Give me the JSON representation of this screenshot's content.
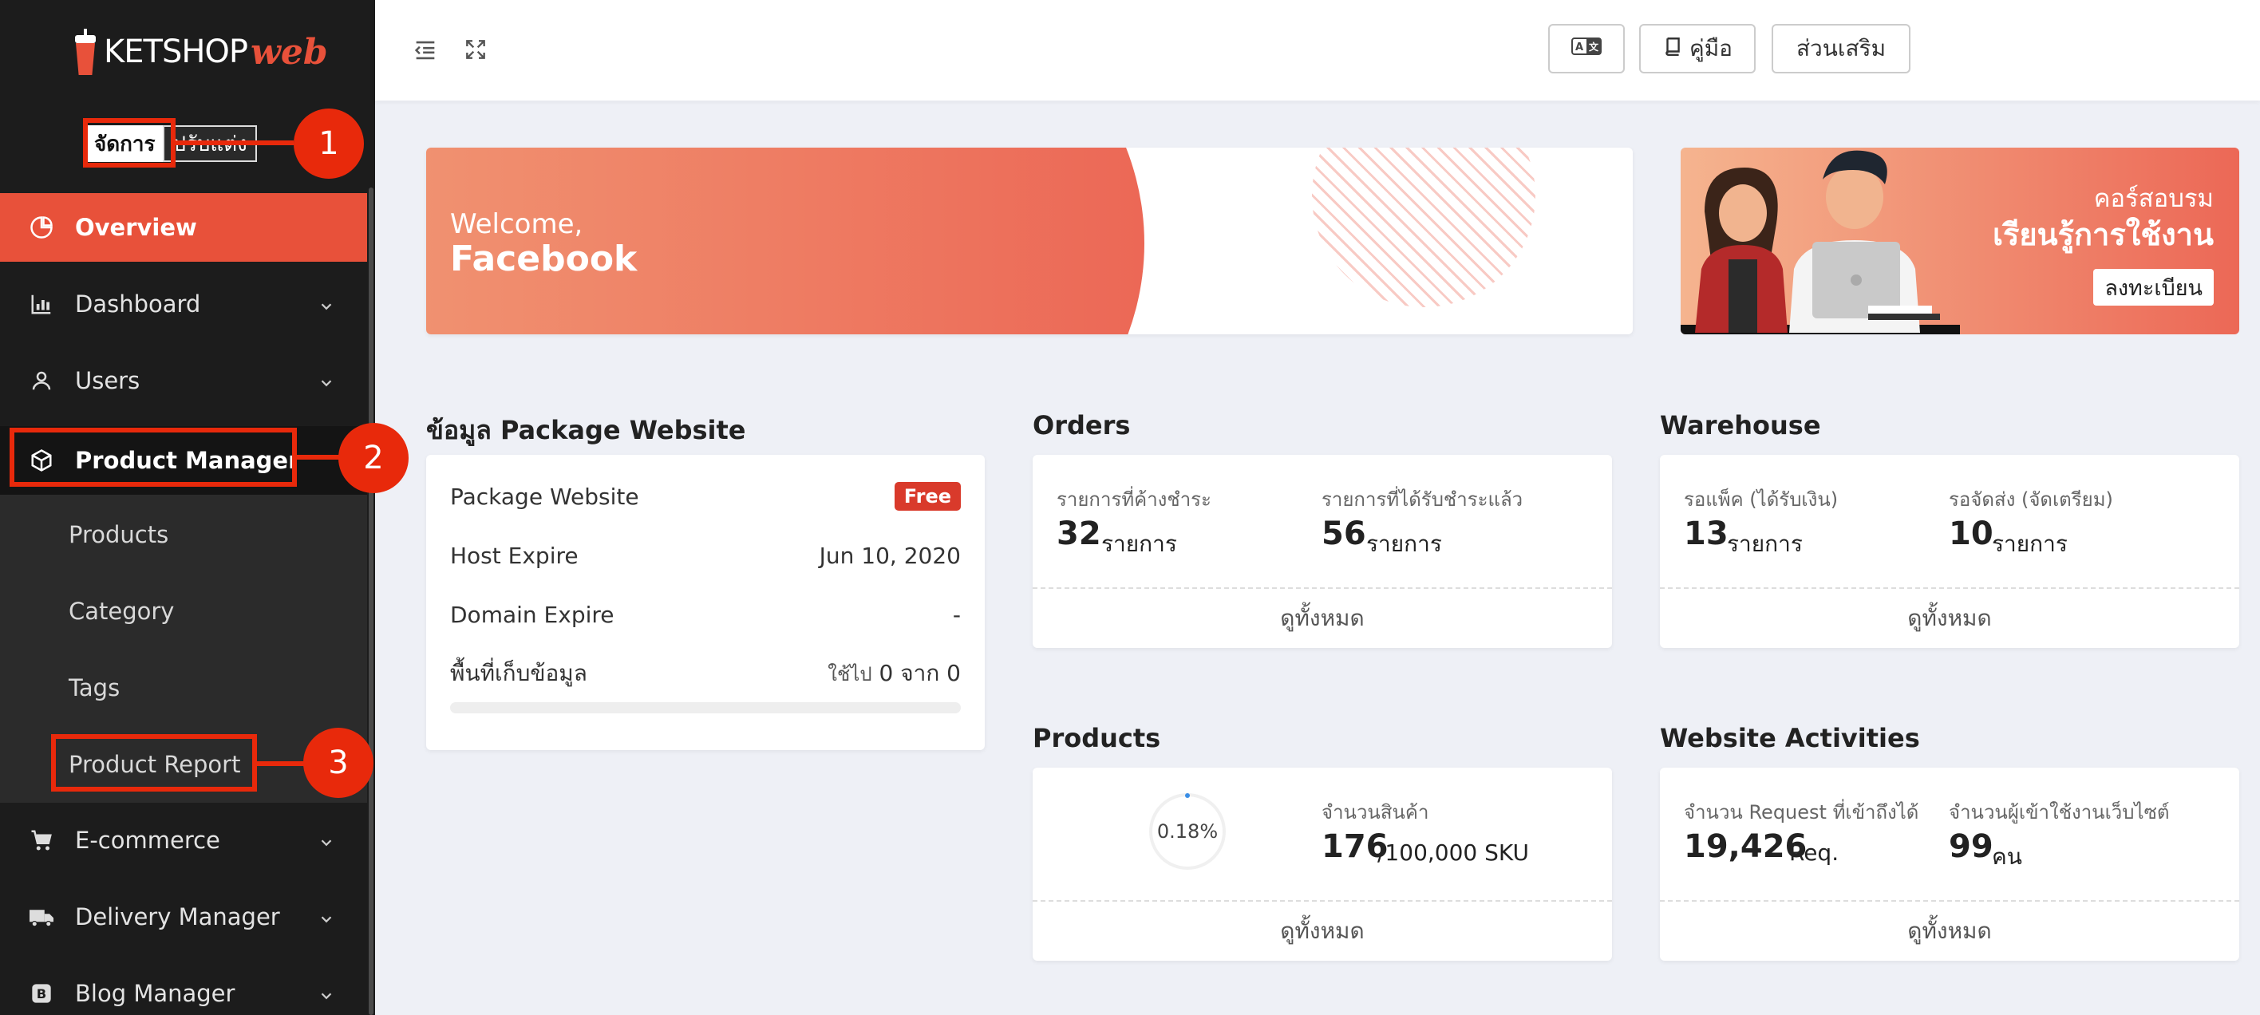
{
  "brand": {
    "name": "KETSHOP",
    "accent": "web"
  },
  "mode_toggle": {
    "active": "จัดการ",
    "inactive": "ปรับแต่ง"
  },
  "sidebar": {
    "items": [
      {
        "label": "Overview",
        "icon": "pie-chart-icon",
        "state": "active"
      },
      {
        "label": "Dashboard",
        "icon": "bar-chart-icon",
        "has_chevron": true
      },
      {
        "label": "Users",
        "icon": "user-icon",
        "has_chevron": true
      },
      {
        "label": "Product Manager",
        "icon": "box-icon",
        "state": "open"
      },
      {
        "label": "E-commerce",
        "icon": "cart-icon",
        "has_chevron": true
      },
      {
        "label": "Delivery Manager",
        "icon": "truck-icon",
        "has_chevron": true
      },
      {
        "label": "Blog Manager",
        "icon": "blog-icon",
        "has_chevron": true
      }
    ],
    "sub_items": [
      "Products",
      "Category",
      "Tags",
      "Product Report"
    ]
  },
  "callouts": [
    "1",
    "2",
    "3"
  ],
  "topbar": {
    "guide_label": "คู่มือ",
    "addons_label": "ส่วนเสริม"
  },
  "welcome": {
    "line1": "Welcome,",
    "line2": "Facebook"
  },
  "course_banner": {
    "line1": "คอร์สอบรม",
    "line2": "เรียนรู้การใช้งาน",
    "button": "ลงทะเบียน"
  },
  "package": {
    "title": "ข้อมูล Package Website",
    "rows": [
      {
        "label": "Package Website",
        "value": "Free"
      },
      {
        "label": "Host Expire",
        "value": "Jun 10, 2020"
      },
      {
        "label": "Domain Expire",
        "value": "-"
      },
      {
        "label": "พื้นที่เก็บข้อมูล",
        "value_prefix": "ใช้ไป",
        "value": "0 จาก 0"
      }
    ],
    "usage_fraction": 0
  },
  "orders": {
    "title": "Orders",
    "pending_label": "รายการที่ค้างชำระ",
    "pending_value": "32",
    "pending_unit": "รายการ",
    "paid_label": "รายการที่ได้รับชำระแล้ว",
    "paid_value": "56",
    "paid_unit": "รายการ",
    "footer": "ดูทั้งหมด"
  },
  "warehouse": {
    "title": "Warehouse",
    "pack_label": "รอแพ็ค (ได้รับเงิน)",
    "pack_value": "13",
    "pack_unit": "รายการ",
    "ship_label": "รอจัดส่ง (จัดเตรียม)",
    "ship_value": "10",
    "ship_unit": "รายการ",
    "footer": "ดูทั้งหมด"
  },
  "products": {
    "title": "Products",
    "percent": "0.18%",
    "count_label": "จำนวนสินค้า",
    "count_value": "176",
    "count_limit": "/100,000 SKU",
    "footer": "ดูทั้งหมด"
  },
  "activities": {
    "title": "Website Activities",
    "req_label": "จำนวน Request ที่เข้าถึงได้",
    "req_value": "19,426",
    "req_unit": "Req.",
    "users_label": "จำนวนผู้เข้าใช้งานเว็บไซต์",
    "users_value": "99",
    "users_unit": "คน",
    "footer": "ดูทั้งหมด"
  },
  "colors": {
    "accent": "#e8513a",
    "callout": "#e8290b",
    "sidebar_bg": "#1c1c1c"
  }
}
